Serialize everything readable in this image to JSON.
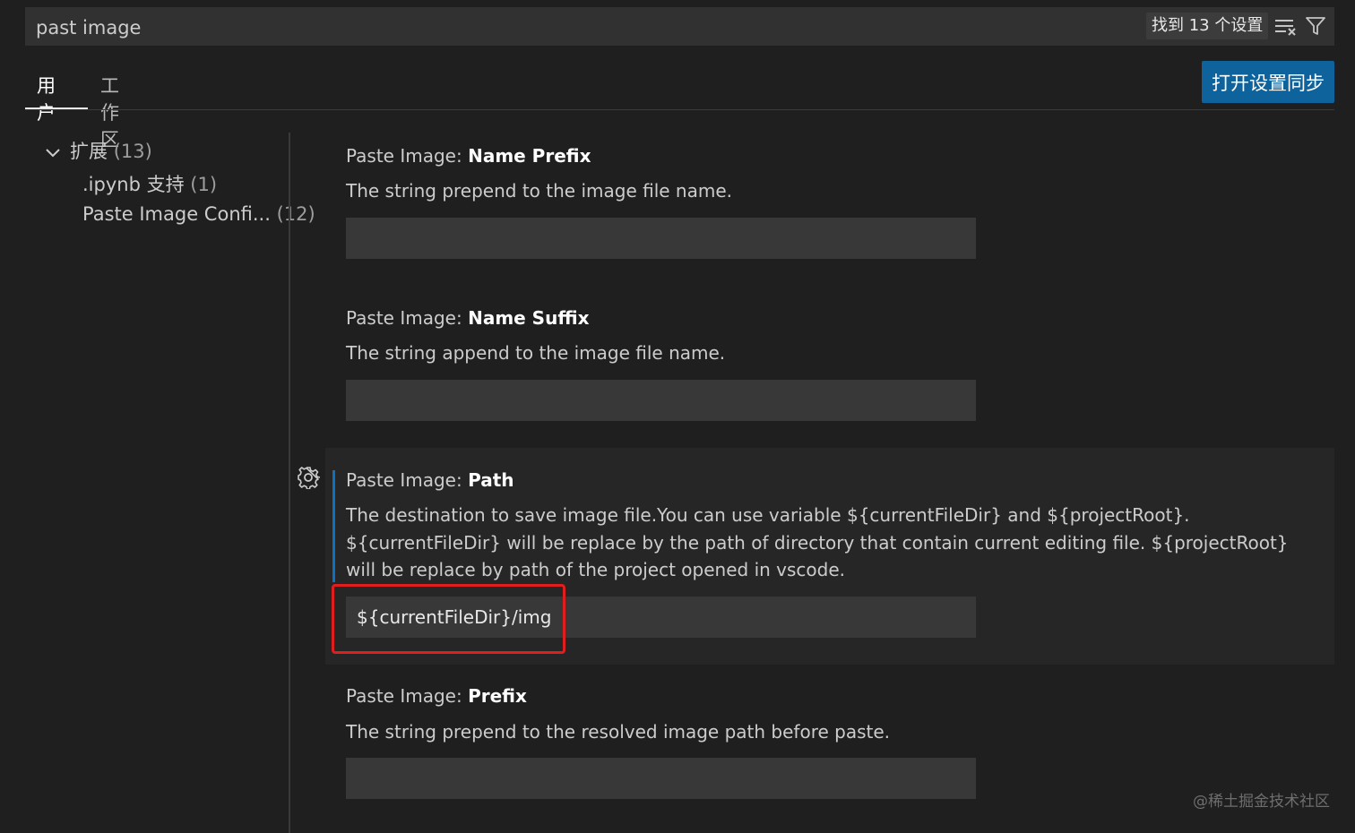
{
  "search": {
    "value": "past image",
    "result_count_label": "找到 13 个设置"
  },
  "tabs": [
    {
      "label": "用户",
      "active": true
    },
    {
      "label": "工作区",
      "active": false
    }
  ],
  "sync_button_label": "打开设置同步",
  "toc": {
    "group": {
      "label": "扩展",
      "count": "(13)"
    },
    "items": [
      {
        "label": ".ipynb 支持",
        "count": "(1)"
      },
      {
        "label": "Paste Image Confi...",
        "count": "(12)"
      }
    ]
  },
  "settings": [
    {
      "category": "Paste Image: ",
      "key": "Name Prefix",
      "description": "The string prepend to the image file name.",
      "value": ""
    },
    {
      "category": "Paste Image: ",
      "key": "Name Suffix",
      "description": "The string append to the image file name.",
      "value": ""
    },
    {
      "category": "Paste Image: ",
      "key": "Path",
      "description": "The destination to save image file.You can use variable ${currentFileDir} and ${projectRoot}. ${currentFileDir} will be replace by the path of directory that contain current editing file. ${projectRoot} will be replace by path of the project opened in vscode.",
      "value": "${currentFileDir}/img"
    },
    {
      "category": "Paste Image: ",
      "key": "Prefix",
      "description": "The string prepend to the resolved image path before paste.",
      "value": ""
    }
  ],
  "watermark": "@稀土掘金技术社区",
  "colors": {
    "accent": "#0e639c",
    "modified_bar": "#0e70c0",
    "highlight": "#e01e1e"
  },
  "icons": [
    "clear-filter-icon",
    "filter-icon",
    "chevron-down-icon",
    "gear-icon"
  ]
}
